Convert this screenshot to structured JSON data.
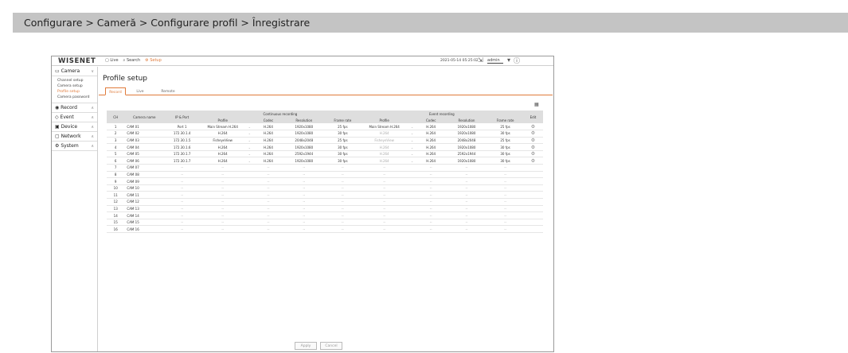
{
  "breadcrumb": "Configurare > Cameră > Configurare profil > Înregistrare",
  "app": {
    "logo": "WISENET",
    "nav": {
      "live": "Live",
      "search": "Search",
      "setup": "Setup"
    },
    "datetime": "2021-05-14 05:25:02",
    "user": "admin",
    "accent_color": "#e07a3a"
  },
  "sidebar": {
    "camera": {
      "label": "Camera",
      "items": [
        "Channel setup",
        "Camera setup",
        "Profile setup",
        "Camera password"
      ]
    },
    "record": "Record",
    "event": "Event",
    "device": "Device",
    "network": "Network",
    "system": "System"
  },
  "page": {
    "title": "Profile setup",
    "tabs": [
      "Record",
      "Live",
      "Remote"
    ]
  },
  "table": {
    "group_continuous": "Continuous recording",
    "group_event": "Event recording",
    "headers": {
      "ch": "CH",
      "camera_name": "Camera name",
      "ip_port": "IP & Port",
      "profile": "Profile",
      "codec": "Codec",
      "resolution": "Resolution",
      "frame_rate": "Frame rate",
      "edit": "Edit"
    },
    "rows": [
      {
        "ch": "1",
        "name": "CAM 01",
        "ip": "Port 1",
        "c_profile": "Main Stream H.264",
        "c_codec": "H.264",
        "c_res": "1920x1080",
        "c_fps": "25 fps",
        "e_profile": "Main Stream H.264",
        "e_codec": "H.264",
        "e_res": "1920x1080",
        "e_fps": "25 fps"
      },
      {
        "ch": "2",
        "name": "CAM 02",
        "ip": "172.30.1.4",
        "c_profile": "H.264",
        "c_codec": "H.264",
        "c_res": "1920x1080",
        "c_fps": "30 fps",
        "e_profile": "H.264",
        "e_codec": "H.264",
        "e_res": "1920x1080",
        "e_fps": "30 fps"
      },
      {
        "ch": "3",
        "name": "CAM 03",
        "ip": "172.30.1.5",
        "c_profile": "FisheyeView",
        "c_codec": "H.264",
        "c_res": "2048x2048",
        "c_fps": "25 fps",
        "e_profile": "FisheyeView",
        "e_codec": "H.264",
        "e_res": "2048x2048",
        "e_fps": "25 fps"
      },
      {
        "ch": "4",
        "name": "CAM 04",
        "ip": "172.30.1.6",
        "c_profile": "H.264",
        "c_codec": "H.264",
        "c_res": "1920x1080",
        "c_fps": "30 fps",
        "e_profile": "H.264",
        "e_codec": "H.264",
        "e_res": "1920x1080",
        "e_fps": "30 fps"
      },
      {
        "ch": "5",
        "name": "CAM 05",
        "ip": "172.30.1.7",
        "c_profile": "H.264",
        "c_codec": "H.264",
        "c_res": "2592x1944",
        "c_fps": "30 fps",
        "e_profile": "H.264",
        "e_codec": "H.264",
        "e_res": "2592x1944",
        "e_fps": "30 fps"
      },
      {
        "ch": "6",
        "name": "CAM 06",
        "ip": "172.30.1.7",
        "c_profile": "H.264",
        "c_codec": "H.264",
        "c_res": "1920x1080",
        "c_fps": "30 fps",
        "e_profile": "H.264",
        "e_codec": "H.264",
        "e_res": "1920x1080",
        "e_fps": "30 fps"
      },
      {
        "ch": "7",
        "name": "CAM 07"
      },
      {
        "ch": "8",
        "name": "CAM 08"
      },
      {
        "ch": "9",
        "name": "CAM 09"
      },
      {
        "ch": "10",
        "name": "CAM 10"
      },
      {
        "ch": "11",
        "name": "CAM 11"
      },
      {
        "ch": "12",
        "name": "CAM 12"
      },
      {
        "ch": "13",
        "name": "CAM 13"
      },
      {
        "ch": "14",
        "name": "CAM 14"
      },
      {
        "ch": "15",
        "name": "CAM 15"
      },
      {
        "ch": "16",
        "name": "CAM 16"
      }
    ],
    "empty_value": "--"
  },
  "buttons": {
    "apply": "Apply",
    "cancel": "Cancel"
  }
}
